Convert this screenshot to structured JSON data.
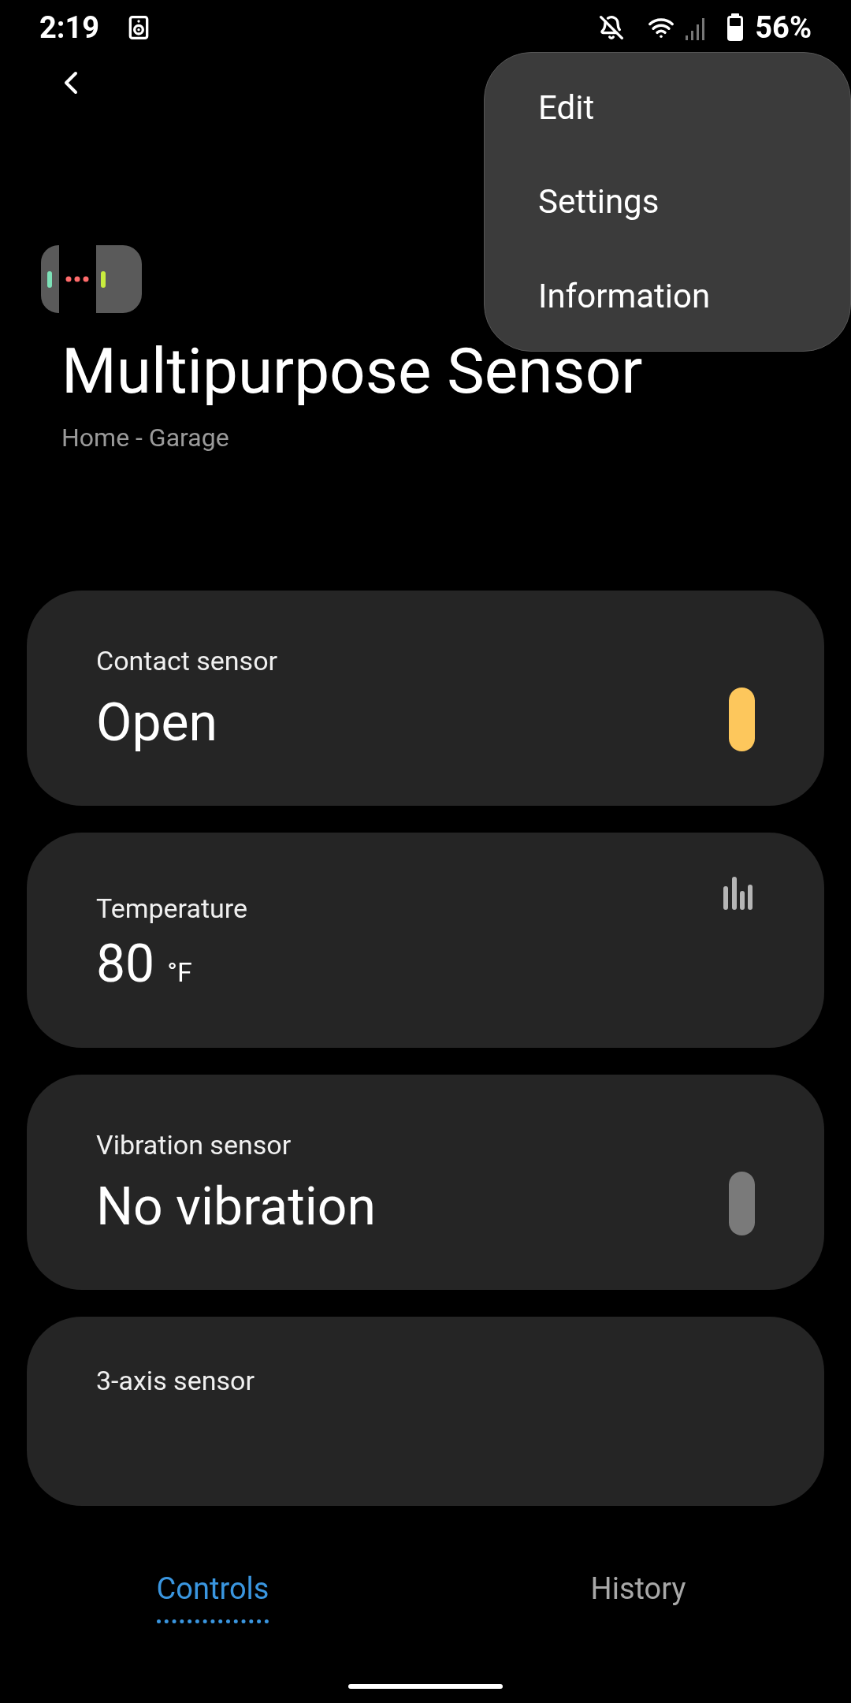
{
  "status_bar": {
    "time": "2:19",
    "battery": "56%"
  },
  "menu": {
    "items": [
      "Edit",
      "Settings",
      "Information"
    ]
  },
  "device": {
    "title": "Multipurpose Sensor",
    "location": "Home - Garage"
  },
  "cards": [
    {
      "kind": "status",
      "label": "Contact sensor",
      "value": "Open",
      "active": true
    },
    {
      "kind": "reading",
      "label": "Temperature",
      "value": "80",
      "unit": "°F"
    },
    {
      "kind": "status",
      "label": "Vibration sensor",
      "value": "No vibration",
      "active": false
    },
    {
      "kind": "header",
      "label": "3-axis sensor"
    }
  ],
  "tabs": [
    {
      "label": "Controls",
      "selected": true
    },
    {
      "label": "History",
      "selected": false
    }
  ]
}
